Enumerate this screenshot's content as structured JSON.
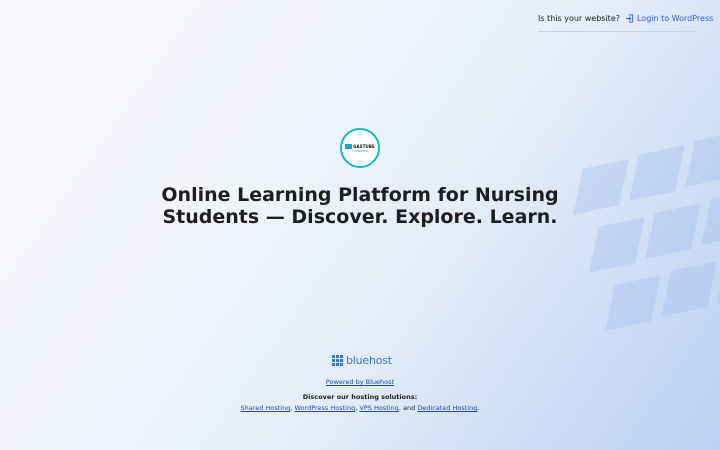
{
  "topbar": {
    "question": "Is this your website?",
    "login_label": "Login to WordPress"
  },
  "logo": {
    "line1": "GASTUBE",
    "line2": "TUTORING"
  },
  "headline": {
    "line1": "Online Learning Platform for Nursing",
    "line2": "Students — Discover. Explore. Learn."
  },
  "brand": {
    "name": "bluehost",
    "color": "#3575d3"
  },
  "footer": {
    "powered_by": "Powered by Bluehost",
    "discover": "Discover our hosting solutions:",
    "links": {
      "shared": "Shared Hosting",
      "wordpress": "WordPress Hosting",
      "vps": "VPS Hosting",
      "dedicated": "Dedicated Hosting"
    },
    "sep": ",",
    "and": "and",
    "end": "."
  },
  "icons": {
    "login": "login-arrow-icon",
    "brand": "bluehost-grid-icon"
  },
  "colors": {
    "link": "#3858e9",
    "logo_ring": "#1ab4c8"
  }
}
